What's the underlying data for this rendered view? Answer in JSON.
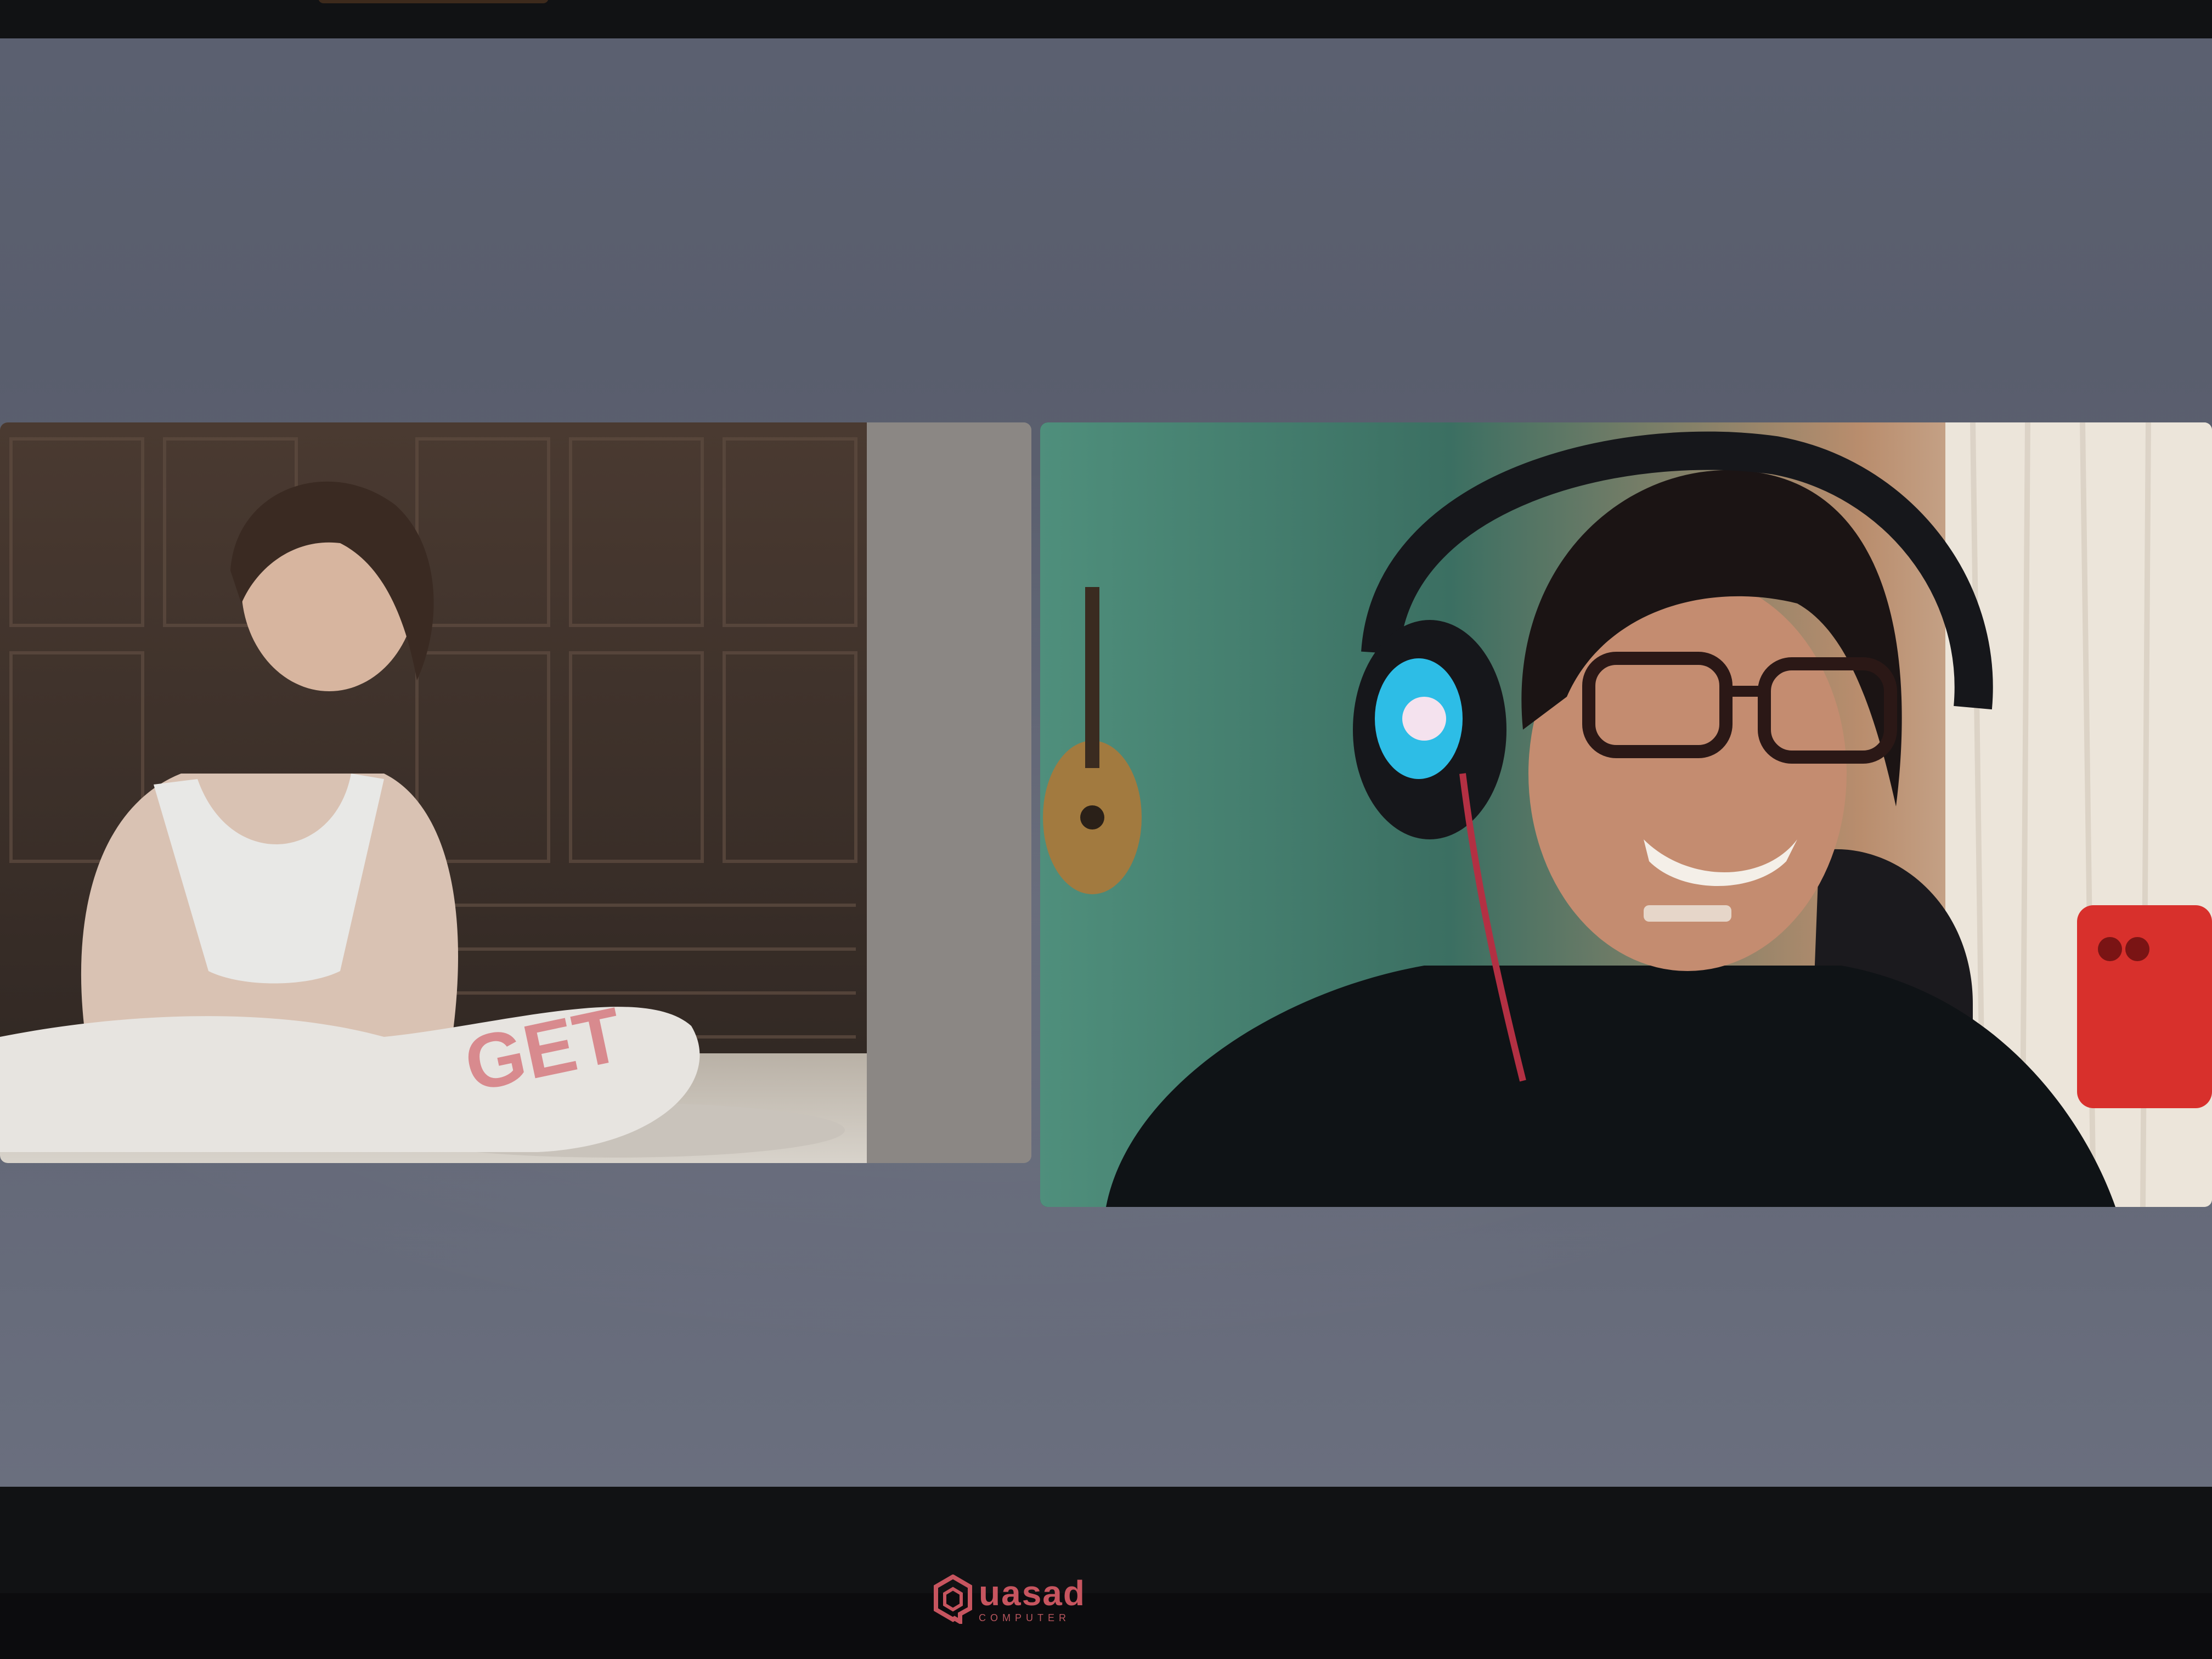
{
  "monitor": {
    "brand_name": "uasad",
    "brand_sub": "COMPUTER"
  },
  "video_call": {
    "participants": [
      {
        "id": "participant-left",
        "muted": null
      },
      {
        "id": "participant-right",
        "muted": null
      }
    ]
  },
  "icons": [
    "quasad-logo-icon"
  ]
}
